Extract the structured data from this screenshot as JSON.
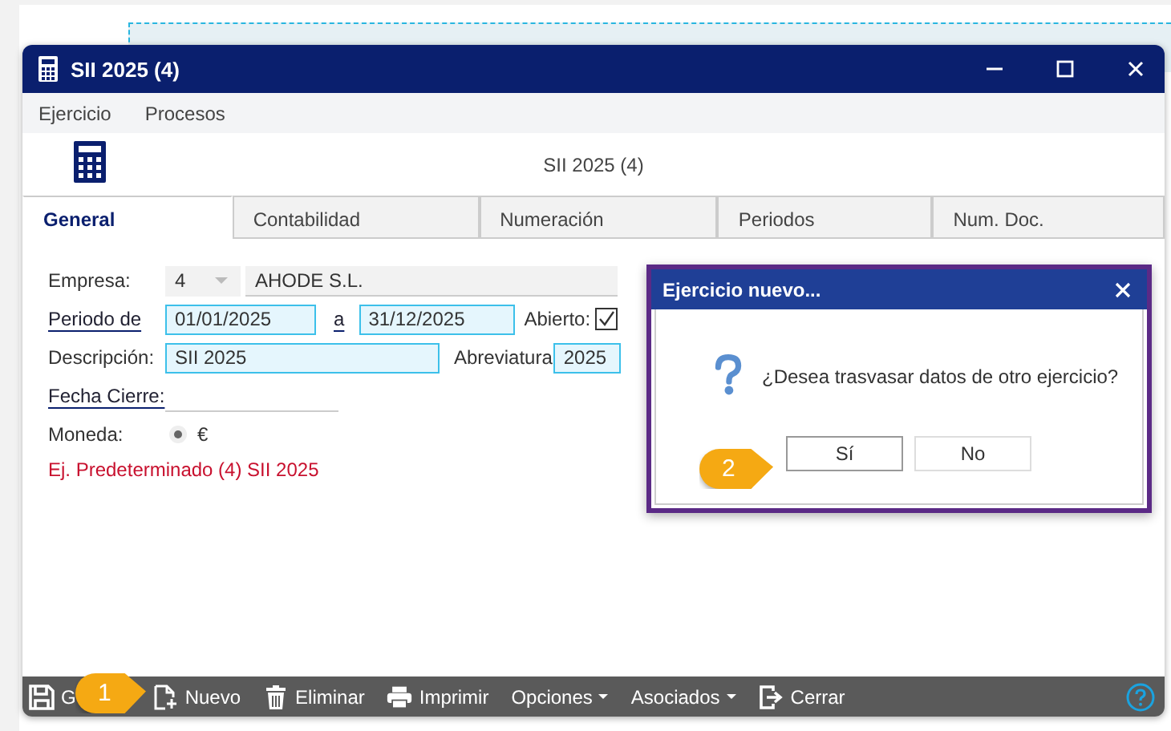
{
  "window": {
    "title": "SII 2025 (4)"
  },
  "menu": [
    "Ejercicio",
    "Procesos"
  ],
  "header": {
    "title": "SII 2025 (4)"
  },
  "tabs": [
    {
      "label": "General",
      "selected": true
    },
    {
      "label": "Contabilidad",
      "selected": false
    },
    {
      "label": "Numeración",
      "selected": false
    },
    {
      "label": "Periodos",
      "selected": false
    },
    {
      "label": "Num. Doc.",
      "selected": false
    }
  ],
  "form": {
    "empresa": {
      "label": "Empresa:",
      "code": "4",
      "name": "AHODE S.L."
    },
    "periodo": {
      "label": "Periodo de",
      "from": "01/01/2025",
      "to_label": "a",
      "to": "31/12/2025"
    },
    "abierto": {
      "label": "Abierto:",
      "checked": true
    },
    "descripcion": {
      "label": "Descripción:",
      "value": "SII 2025"
    },
    "abreviatura": {
      "label": "Abreviatura",
      "value": "2025"
    },
    "fecha_cierre": {
      "label": "Fecha Cierre:"
    },
    "moneda": {
      "label": "Moneda:",
      "symbol": "€",
      "selected": true
    },
    "note": "Ej. Predeterminado (4) SII 2025"
  },
  "toolbar": [
    {
      "label": "G",
      "kind": "save"
    },
    {
      "label": "Nuevo",
      "kind": "new"
    },
    {
      "label": "Eliminar",
      "kind": "delete"
    },
    {
      "label": "Imprimir",
      "kind": "print"
    },
    {
      "label": "Opciones",
      "kind": "dropdown"
    },
    {
      "label": "Asociados",
      "kind": "dropdown"
    },
    {
      "label": "Cerrar",
      "kind": "close"
    }
  ],
  "dialog": {
    "title": "Ejercicio nuevo...",
    "message": "¿Desea trasvasar datos de otro ejercicio?",
    "buttons": [
      {
        "label": "Sí",
        "focused": true
      },
      {
        "label": "No",
        "focused": false
      }
    ]
  },
  "callouts": [
    "1",
    "2"
  ]
}
